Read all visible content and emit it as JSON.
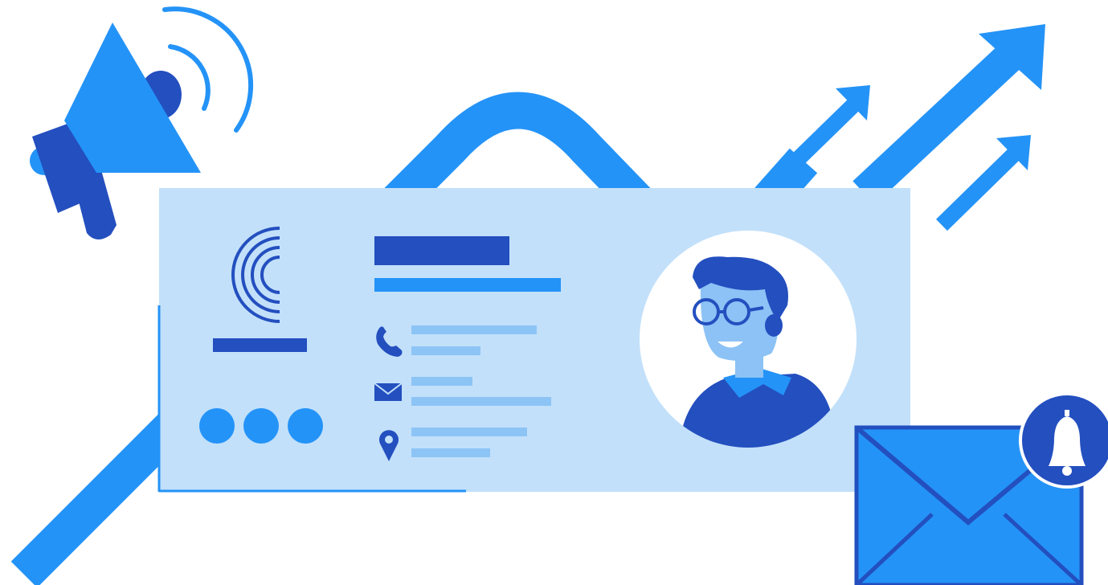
{
  "illustration": {
    "kind": "marketing-business-card",
    "colors": {
      "primary": "#2493F7",
      "dark": "#234FBF",
      "card": "#C2E0FA",
      "placeholder_line": "#8DC4F6",
      "face": "#8CC2F5",
      "white": "#FFFFFF"
    },
    "icons": [
      "megaphone-icon",
      "growth-arrow-icon",
      "business-card",
      "avatar",
      "phone-icon",
      "mail-icon",
      "location-pin-icon",
      "envelope-icon",
      "bell-icon"
    ]
  }
}
